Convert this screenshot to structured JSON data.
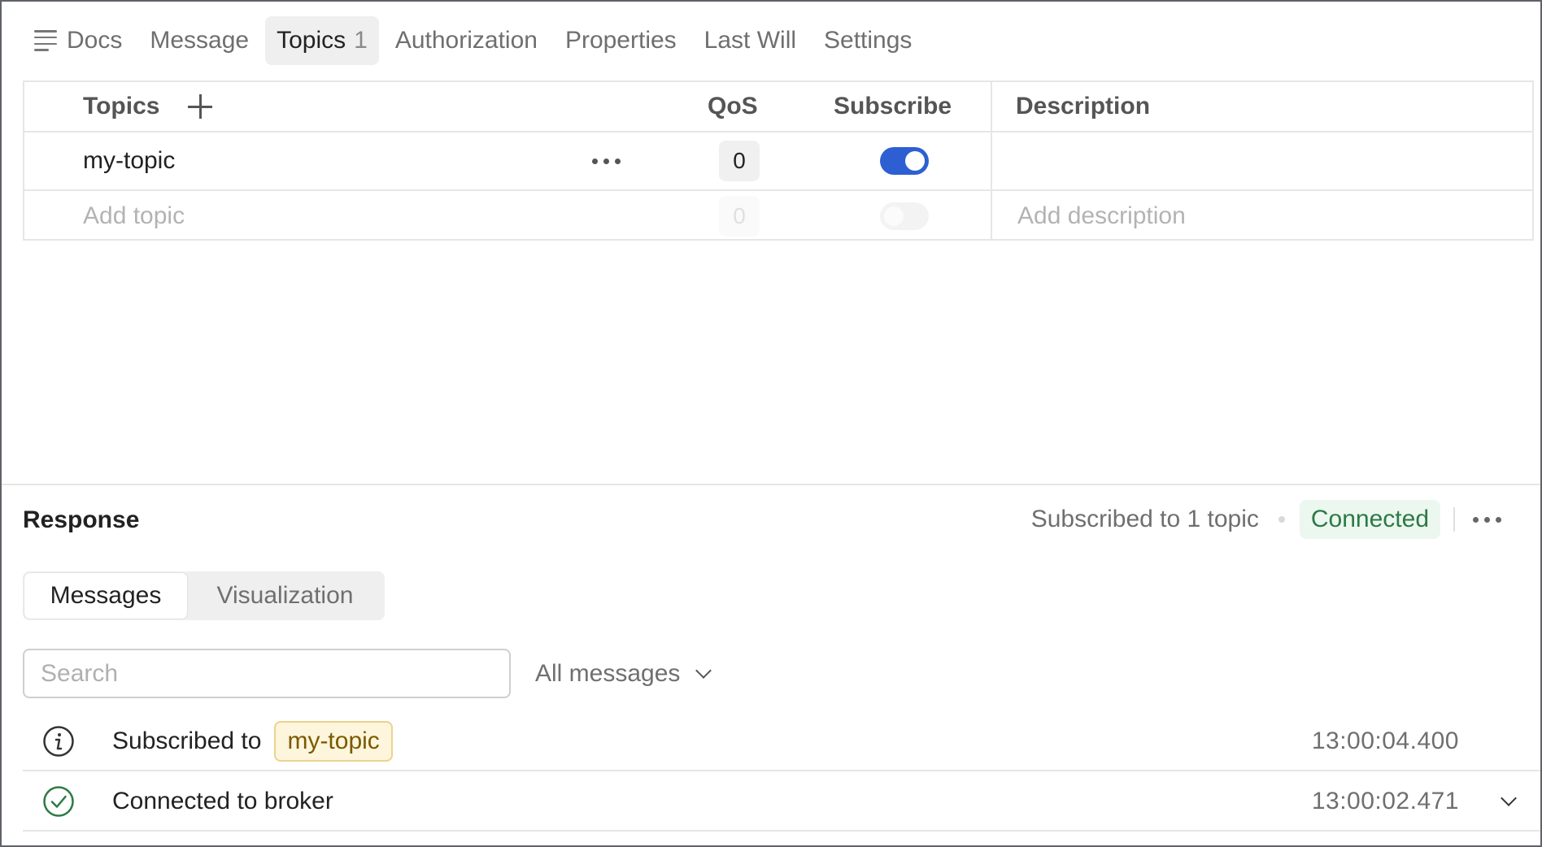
{
  "tabs": [
    {
      "label": "Docs"
    },
    {
      "label": "Message"
    },
    {
      "label": "Topics",
      "count": "1"
    },
    {
      "label": "Authorization"
    },
    {
      "label": "Properties"
    },
    {
      "label": "Last Will"
    },
    {
      "label": "Settings"
    }
  ],
  "topics_table": {
    "headers": {
      "topics": "Topics",
      "qos": "QoS",
      "subscribe": "Subscribe",
      "description": "Description"
    },
    "rows": [
      {
        "topic": "my-topic",
        "qos": "0",
        "subscribed": true,
        "description": ""
      }
    ],
    "new_row": {
      "topic_placeholder": "Add topic",
      "qos": "0",
      "subscribed": false,
      "description_placeholder": "Add description"
    }
  },
  "response": {
    "title": "Response",
    "subscription_summary": "Subscribed to 1 topic",
    "connection_status": "Connected",
    "colors": {
      "connected_bg": "#ecf7ef",
      "connected_text": "#2c7a45",
      "toggle_on": "#2d5fd3",
      "chip_bg": "#fdf5dc"
    },
    "views": [
      {
        "label": "Messages",
        "active": true
      },
      {
        "label": "Visualization",
        "active": false
      }
    ],
    "search": {
      "placeholder": "Search",
      "value": ""
    },
    "filter": {
      "selected": "All messages"
    },
    "messages": [
      {
        "icon": "info-icon",
        "text": "Subscribed to",
        "topic": "my-topic",
        "time": "13:00:04.400"
      },
      {
        "icon": "check-circle-icon",
        "text": "Connected to broker",
        "time": "13:00:02.471",
        "expandable": true
      }
    ]
  }
}
